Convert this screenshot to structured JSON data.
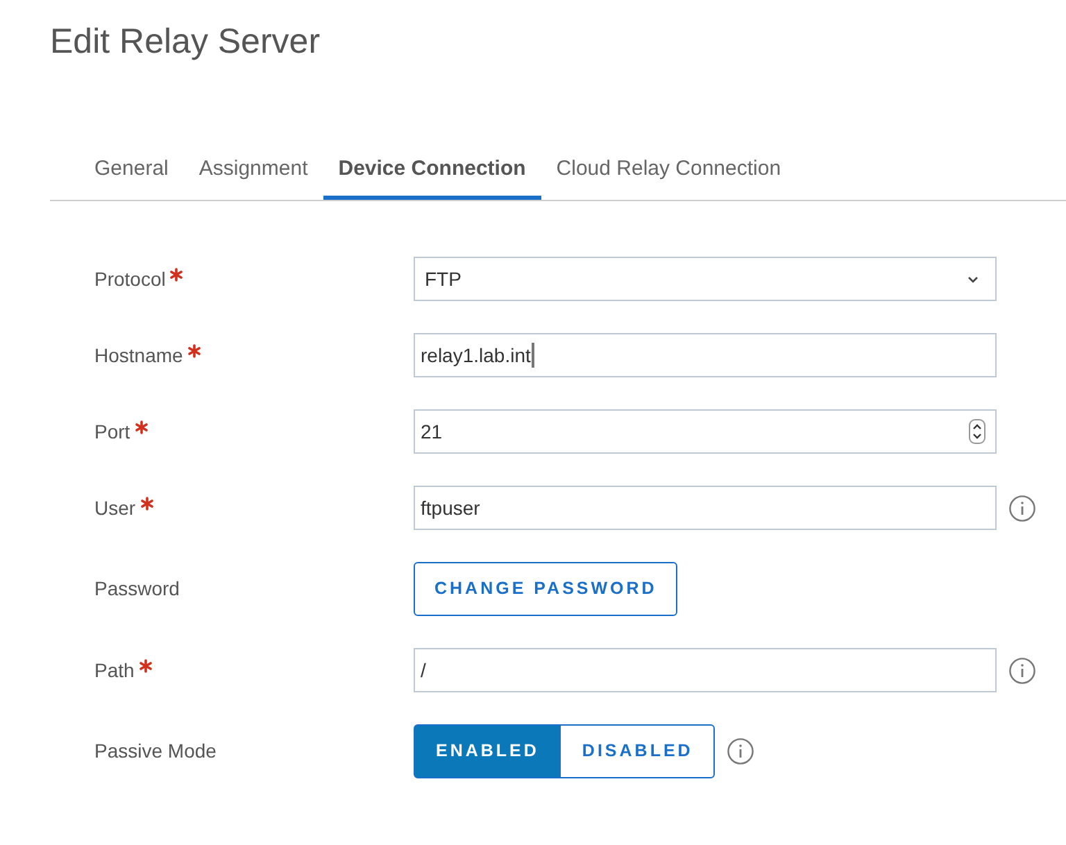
{
  "title": "Edit Relay Server",
  "tabs": [
    {
      "label": "General",
      "selected": false
    },
    {
      "label": "Assignment",
      "selected": false
    },
    {
      "label": "Device Connection",
      "selected": true
    },
    {
      "label": "Cloud Relay Connection",
      "selected": false
    }
  ],
  "fields": [
    {
      "kind": "select",
      "label": "Protocol",
      "required": true,
      "value": "FTP"
    },
    {
      "kind": "text",
      "label": "Hostname",
      "required": true,
      "value": "relay1.lab.int",
      "focused": true
    },
    {
      "kind": "number",
      "label": "Port",
      "required": true,
      "value": "21"
    },
    {
      "kind": "text",
      "label": "User",
      "required": true,
      "value": "ftpuser",
      "info": true
    },
    {
      "kind": "button",
      "label": "Password",
      "required": false,
      "button": "CHANGE PASSWORD"
    },
    {
      "kind": "text",
      "label": "Path",
      "required": true,
      "value": "/",
      "info": true
    },
    {
      "kind": "toggle",
      "label": "Passive Mode",
      "required": false,
      "options": [
        {
          "label": "ENABLED",
          "selected": true
        },
        {
          "label": "DISABLED",
          "selected": false
        }
      ],
      "info": true
    }
  ]
}
